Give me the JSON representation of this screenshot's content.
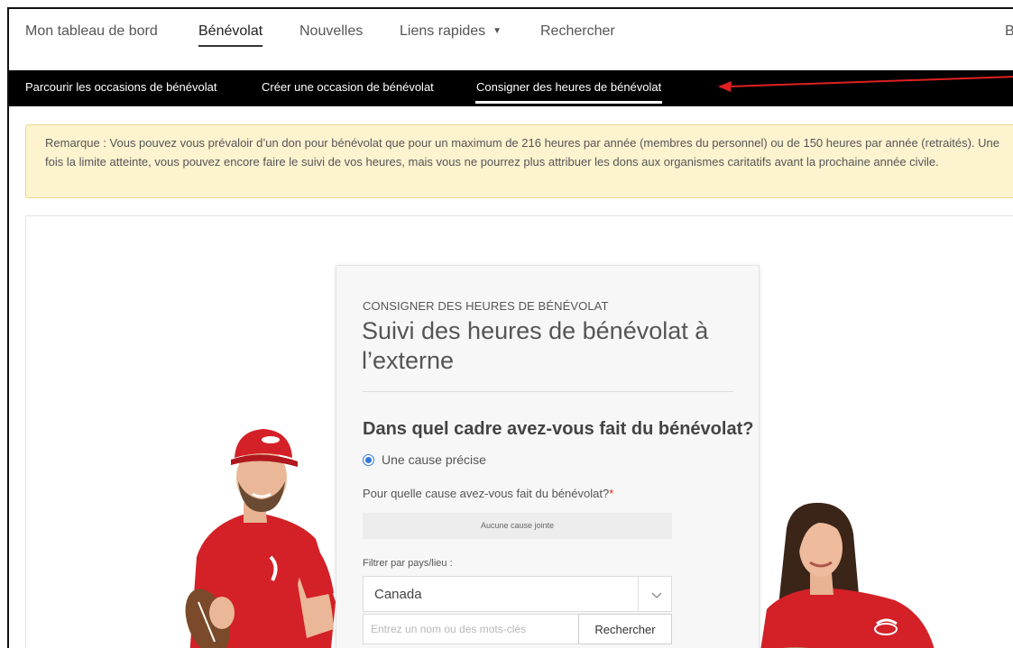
{
  "topnav": {
    "items": [
      "Mon tableau de bord",
      "Bénévolat",
      "Nouvelles",
      "Liens rapides",
      "Rechercher",
      "B"
    ]
  },
  "subnav": {
    "items": [
      "Parcourir les occasions de bénévolat",
      "Créer une occasion de bénévolat",
      "Consigner des heures de bénévolat"
    ]
  },
  "notice": {
    "text": "Remarque : Vous pouvez vous prévaloir d’un don pour bénévolat que pour un maximum de 216 heures par année (membres du personnel) ou de 150 heures par année (retraités). Une fois la limite atteinte, vous pouvez encore faire le suivi de vos heures, mais vous ne pourrez plus attribuer les dons aux organismes caritatifs avant la prochaine année civile."
  },
  "form": {
    "eyebrow": "CONSIGNER DES HEURES DE BÉNÉVOLAT",
    "title": "Suivi des heures de bénévolat à l’externe",
    "question": "Dans quel cadre avez-vous fait du bénévolat?",
    "radio_label": "Une cause précise",
    "cause_label": "Pour quelle cause avez-vous fait du bénévolat?",
    "required_mark": "*",
    "no_cause": "Aucune cause jointe",
    "filter_label": "Filtrer par pays/lieu :",
    "country_value": "Canada",
    "search_placeholder": "Entrez un nom ou des mots-clés",
    "search_button": "Rechercher"
  },
  "colors": {
    "notice_bg": "#fdf3cf",
    "subnav_bg": "#000000",
    "arrow": "#e02020",
    "brand_red": "#d9261c",
    "radio_blue": "#2f7bd8"
  },
  "icons": {
    "dropdown_caret": "caret-down-icon",
    "select_chevron": "chevron-down-icon",
    "annotation_arrow": "arrow-left-icon"
  }
}
